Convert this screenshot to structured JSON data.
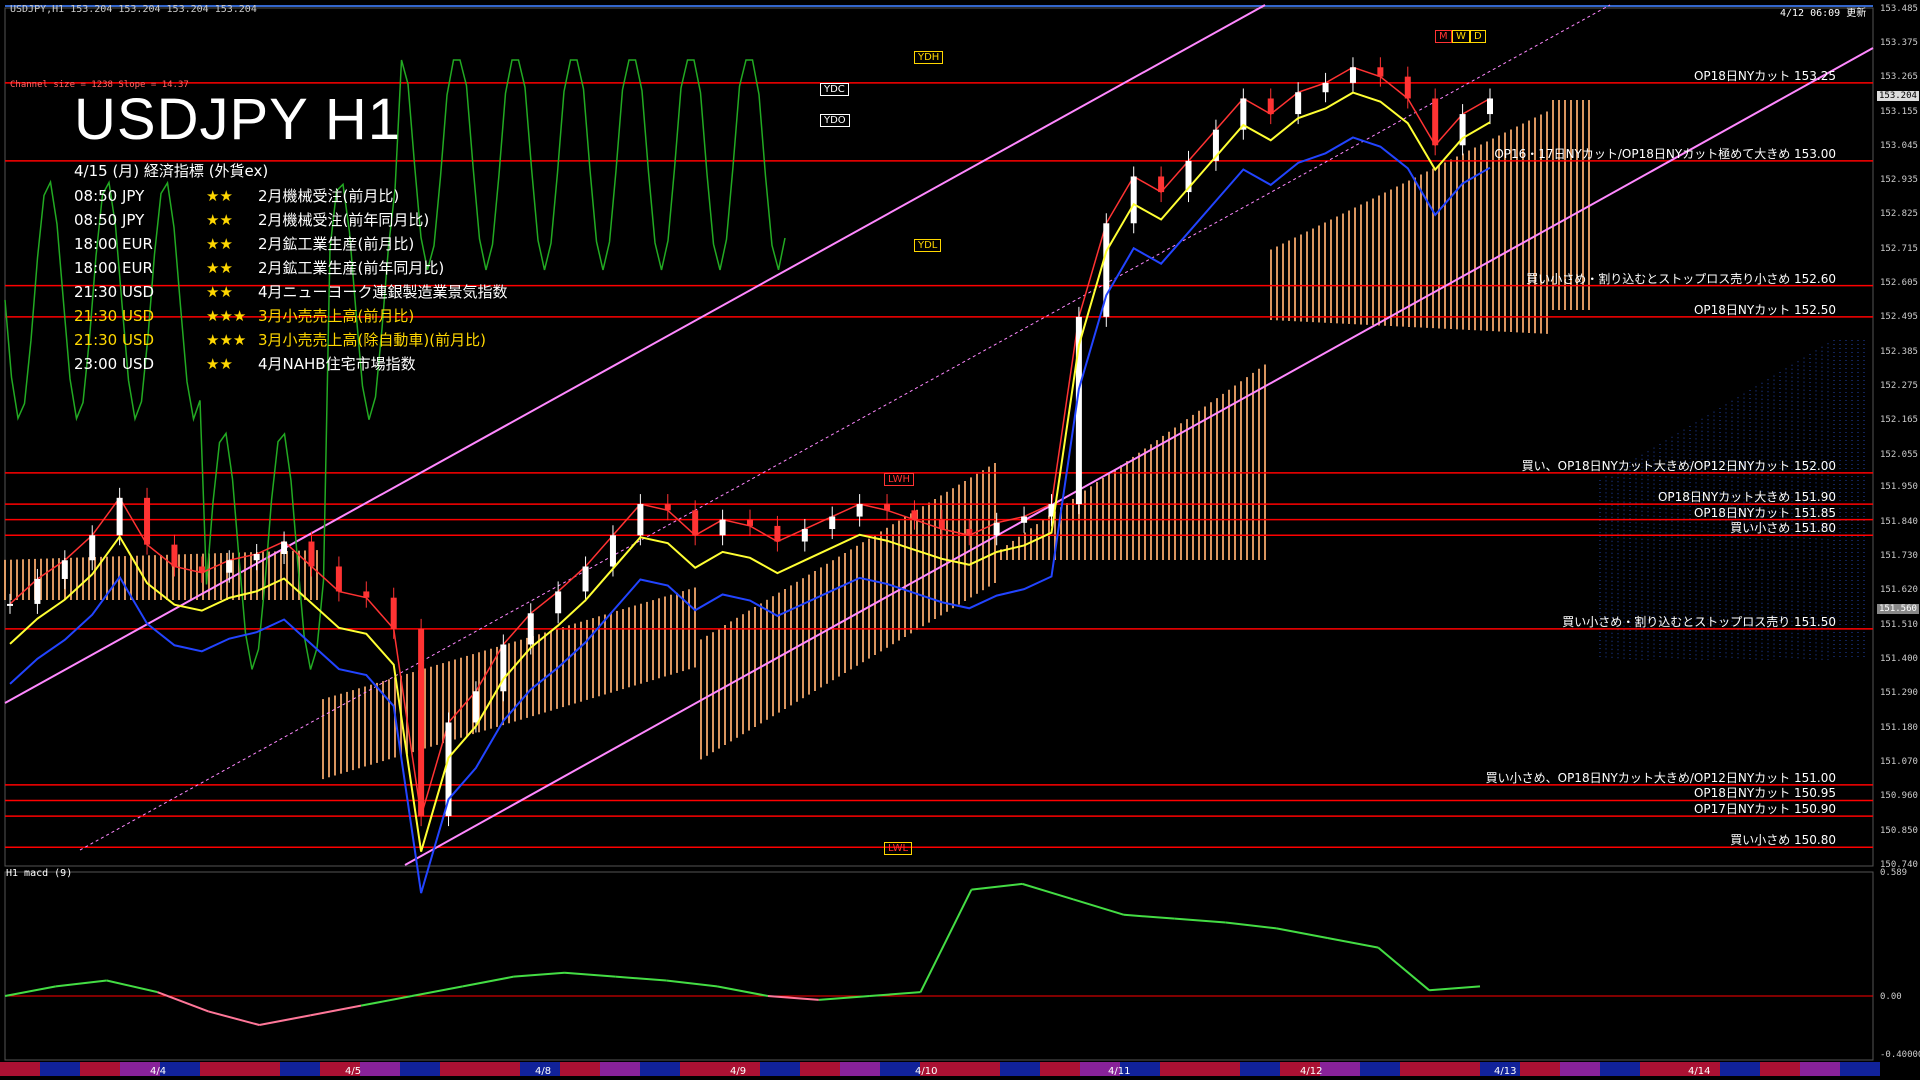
{
  "header": {
    "symbol_info": "USDJPY,H1  153.204 153.204 153.204 153.204",
    "timestamp": "4/12 06:09 更新",
    "channel_info": "Channel size = 1238 Slope = 14.37"
  },
  "title": "USDJPY H1",
  "calendar": {
    "heading": "4/15 (月) 経済指標 (外貨ex)",
    "rows": [
      {
        "time": "08:50  JPY",
        "stars": "★★",
        "event": "2月機械受注(前月比)",
        "highlight": false
      },
      {
        "time": "08:50  JPY",
        "stars": "★★",
        "event": "2月機械受注(前年同月比)",
        "highlight": false
      },
      {
        "time": "18:00  EUR",
        "stars": "★★",
        "event": "2月鉱工業生産(前月比)",
        "highlight": false
      },
      {
        "time": "18:00  EUR",
        "stars": "★★",
        "event": "2月鉱工業生産(前年同月比)",
        "highlight": false
      },
      {
        "time": "21:30  USD",
        "stars": "★★",
        "event": "4月ニューヨーク連銀製造業景気指数",
        "highlight": false
      },
      {
        "time": "21:30  USD",
        "stars": "★★★",
        "event": "3月小売売上高(前月比)",
        "highlight": true
      },
      {
        "time": "21:30  USD",
        "stars": "★★★",
        "event": "3月小売売上高(除自動車)(前月比)",
        "highlight": true
      },
      {
        "time": "23:00  USD",
        "stars": "★★",
        "event": "4月NAHB住宅市場指数",
        "highlight": false
      }
    ]
  },
  "level_notes": [
    {
      "text": "OP18日NYカット 153.25",
      "price": 153.25
    },
    {
      "text": "OP16・17日NYカット/OP18日NYカット極めて大きめ 153.00",
      "price": 153.0
    },
    {
      "text": "買い小さめ・割り込むとストップロス売り小さめ 152.60",
      "price": 152.6
    },
    {
      "text": "OP18日NYカット 152.50",
      "price": 152.5
    },
    {
      "text": "買い、OP18日NYカット大きめ/OP12日NYカット 152.00",
      "price": 152.0
    },
    {
      "text": "OP18日NYカット大きめ 151.90",
      "price": 151.9
    },
    {
      "text": "OP18日NYカット 151.85",
      "price": 151.85
    },
    {
      "text": "買い小さめ 151.80",
      "price": 151.8
    },
    {
      "text": "買い小さめ・割り込むとストップロス売り 151.50",
      "price": 151.5
    },
    {
      "text": "買い小さめ、OP18日NYカット大きめ/OP12日NYカット 151.00",
      "price": 151.0
    },
    {
      "text": "OP18日NYカット 150.95",
      "price": 150.95
    },
    {
      "text": "OP17日NYカット 150.90",
      "price": 150.9
    },
    {
      "text": "買い小さめ 150.80",
      "price": 150.8
    }
  ],
  "tags": {
    "ydh": "YDH",
    "ydc": "YDC",
    "ydo": "YDO",
    "ydl": "YDL",
    "lwh": "LWH",
    "lwl": "LWL",
    "m": "M",
    "w": "W",
    "d": "D"
  },
  "macd": {
    "label": "H1  macd (9)",
    "top": "0.589",
    "zero": "0.00",
    "bottom": "-0.40000"
  },
  "chart_data": {
    "type": "line",
    "title": "USDJPY H1",
    "price_axis": [
      153.485,
      153.375,
      153.265,
      153.155,
      153.045,
      152.935,
      152.825,
      152.715,
      152.605,
      152.495,
      152.385,
      152.275,
      152.165,
      152.055,
      151.95,
      151.84,
      151.73,
      151.62,
      151.51,
      151.4,
      151.29,
      151.18,
      151.07,
      150.96,
      150.85,
      150.74
    ],
    "current_price": "153.204",
    "cursor_price": "151.560",
    "ylim": [
      150.74,
      153.49
    ],
    "x_dates": [
      "4/4",
      "4/5",
      "4/8",
      "4/9",
      "4/10",
      "4/11",
      "4/12",
      "4/13",
      "4/14"
    ],
    "series": [
      {
        "name": "close",
        "values": [
          151.58,
          151.66,
          151.72,
          151.8,
          151.92,
          151.77,
          151.7,
          151.68,
          151.72,
          151.74,
          151.78,
          151.7,
          151.62,
          151.6,
          151.5,
          150.9,
          151.2,
          151.3,
          151.45,
          151.55,
          151.62,
          151.7,
          151.8,
          151.9,
          151.88,
          151.8,
          151.85,
          151.83,
          151.78,
          151.82,
          151.86,
          151.9,
          151.88,
          151.85,
          151.82,
          151.8,
          151.84,
          151.86,
          151.9,
          152.5,
          152.8,
          152.95,
          152.9,
          153.0,
          153.1,
          153.2,
          153.15,
          153.22,
          153.25,
          153.3,
          153.27,
          153.2,
          153.05,
          153.15,
          153.2
        ]
      }
    ],
    "macd_values": [
      0.0,
      0.05,
      0.08,
      0.02,
      -0.08,
      -0.15,
      -0.1,
      -0.05,
      0.0,
      0.05,
      0.1,
      0.12,
      0.1,
      0.08,
      0.05,
      0.0,
      -0.02,
      0.0,
      0.02,
      0.55,
      0.58,
      0.5,
      0.42,
      0.4,
      0.38,
      0.35,
      0.3,
      0.25,
      0.03,
      0.05
    ],
    "colors": {
      "background": "#000000",
      "level_line": "#ff0000",
      "channel": "#ff88ff",
      "rsi": "#22aa22",
      "ma_yellow": "#ffff33",
      "ma_blue": "#2244ff",
      "cloud": "#ffb070",
      "macd_up": "#44dd44",
      "macd_down": "#ff7799"
    }
  }
}
